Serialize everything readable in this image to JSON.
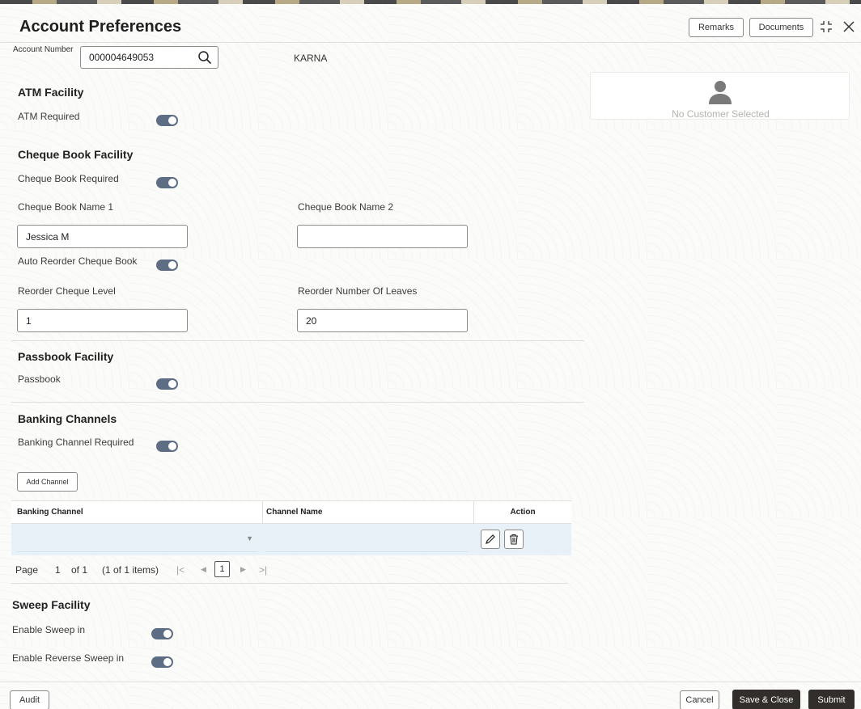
{
  "header": {
    "title": "Account Preferences",
    "remarks_label": "Remarks",
    "documents_label": "Documents"
  },
  "account": {
    "label": "Account Number",
    "value": "000004649053",
    "customer_name": "KARNA"
  },
  "customer_card": {
    "empty_text": "No Customer Selected"
  },
  "atm": {
    "section_title": "ATM Facility",
    "required_label": "ATM Required",
    "required_on": true
  },
  "cheque": {
    "section_title": "Cheque Book Facility",
    "required_label": "Cheque Book Required",
    "required_on": true,
    "name1_label": "Cheque Book Name 1",
    "name1_value": "Jessica M",
    "name2_label": "Cheque Book Name 2",
    "name2_value": "",
    "auto_reorder_label": "Auto Reorder Cheque Book",
    "auto_reorder_on": true,
    "reorder_level_label": "Reorder Cheque Level",
    "reorder_level_value": "1",
    "reorder_leaves_label": "Reorder Number Of Leaves",
    "reorder_leaves_value": "20"
  },
  "passbook": {
    "section_title": "Passbook Facility",
    "label": "Passbook",
    "on": true
  },
  "banking": {
    "section_title": "Banking Channels",
    "required_label": "Banking Channel Required",
    "required_on": true,
    "add_button": "Add Channel",
    "columns": [
      "Banking Channel",
      "Channel Name",
      "Action"
    ],
    "pager": {
      "page_label": "Page",
      "page": "1",
      "of_label": "of 1",
      "items_label": "(1 of 1 items)",
      "current": "1"
    }
  },
  "sweep": {
    "section_title": "Sweep Facility",
    "enable_label": "Enable Sweep in",
    "enable_on": true,
    "reverse_label": "Enable Reverse Sweep in",
    "reverse_on": true
  },
  "footer": {
    "audit_label": "Audit",
    "cancel_label": "Cancel",
    "save_close_label": "Save & Close",
    "submit_label": "Submit"
  },
  "colors": {
    "toggle_on": "#5c6d84",
    "primary_button": "#312e2b",
    "row_highlight": "#e7f1f7"
  }
}
